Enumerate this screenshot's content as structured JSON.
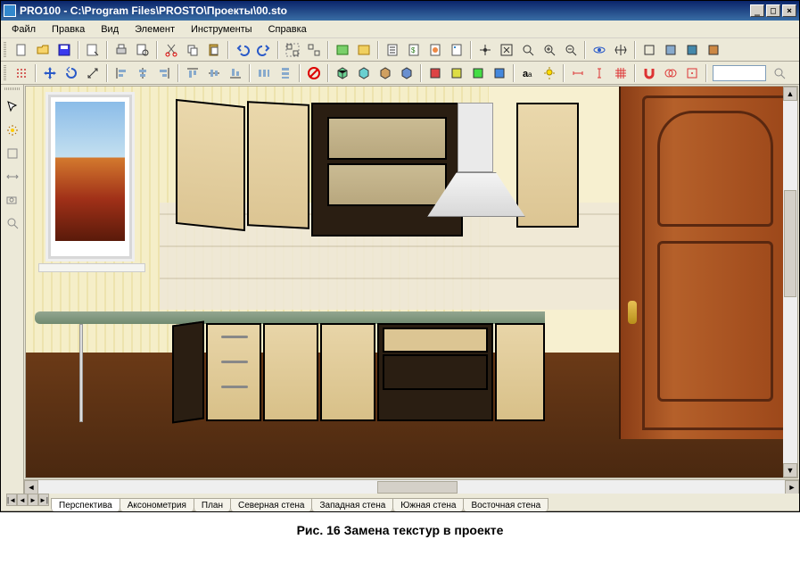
{
  "title": "PRO100 - C:\\Program Files\\PROSTO\\Проекты\\00.sto",
  "menu": {
    "file": "Файл",
    "edit": "Правка",
    "view": "Вид",
    "element": "Элемент",
    "tools": "Инструменты",
    "help": "Справка"
  },
  "tabs": {
    "perspective": "Перспектива",
    "axonometry": "Аксонометрия",
    "plan": "План",
    "north": "Северная стена",
    "west": "Западная стена",
    "south": "Южная стена",
    "east": "Восточная стена"
  },
  "caption": "Рис. 16  Замена текстур  в проекте",
  "toolbar1": {
    "new": "new",
    "open": "open",
    "save": "save",
    "props": "properties",
    "print": "print",
    "preview": "print-preview",
    "cut": "cut",
    "copy": "copy",
    "paste": "paste",
    "undo": "undo",
    "redo": "redo",
    "group": "group",
    "ungroup": "ungroup",
    "store": "store-module",
    "lib": "library",
    "cat": "catalog",
    "price": "price",
    "pan": "pan",
    "rot": "rotate",
    "zoom": "zoom",
    "zoomfit": "zoom-fit"
  },
  "winbtn": {
    "min": "_",
    "max": "□",
    "close": "×"
  }
}
